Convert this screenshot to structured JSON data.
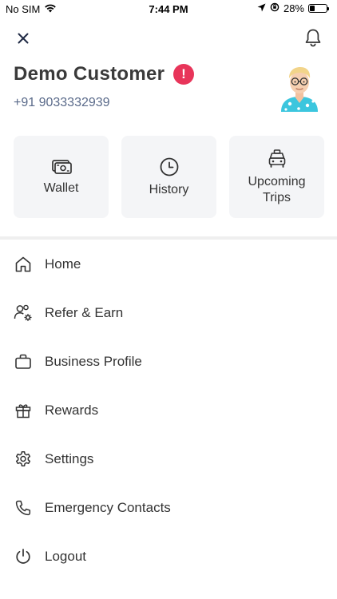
{
  "status_bar": {
    "carrier": "No SIM",
    "time": "7:44 PM",
    "battery_percent": "28%",
    "battery_level": 0.28
  },
  "header": {
    "close_icon": "close-icon",
    "notifications_icon": "bell-icon"
  },
  "user": {
    "name": "Demo Customer",
    "alert_symbol": "!",
    "phone": "+91 9033332939",
    "alert_color": "#e8355a"
  },
  "tiles": [
    {
      "label": "Wallet",
      "icon": "wallet-icon"
    },
    {
      "label": "History",
      "icon": "clock-icon"
    },
    {
      "label": "Upcoming Trips",
      "icon": "taxi-icon"
    }
  ],
  "menu": [
    {
      "label": "Home",
      "icon": "home-icon"
    },
    {
      "label": "Refer & Earn",
      "icon": "refer-icon"
    },
    {
      "label": "Business Profile",
      "icon": "briefcase-icon"
    },
    {
      "label": "Rewards",
      "icon": "gift-icon"
    },
    {
      "label": "Settings",
      "icon": "gear-icon"
    },
    {
      "label": "Emergency Contacts",
      "icon": "phone-icon"
    },
    {
      "label": "Logout",
      "icon": "power-icon"
    }
  ]
}
